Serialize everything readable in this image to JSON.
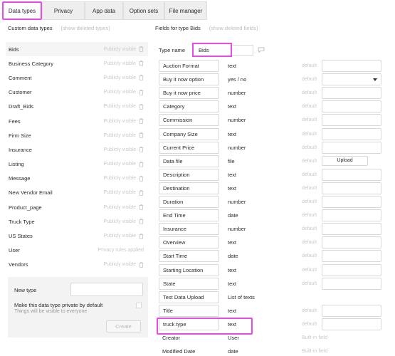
{
  "tabs": [
    {
      "label": "Data types",
      "active": true
    },
    {
      "label": "Privacy"
    },
    {
      "label": "App data"
    },
    {
      "label": "Option sets"
    },
    {
      "label": "File manager"
    }
  ],
  "left_header": {
    "title": "Custom data types",
    "link": "(show deleted types)"
  },
  "right_header": {
    "title": "Fields for type Bids",
    "link": "(show deleted fields)"
  },
  "types": [
    {
      "name": "Bids",
      "status": "Publicly visible",
      "selected": true
    },
    {
      "name": "Business Category",
      "status": "Publicly visible"
    },
    {
      "name": "Comment",
      "status": "Publicly visible"
    },
    {
      "name": "Customer",
      "status": "Publicly visible"
    },
    {
      "name": "Draft_Bids",
      "status": "Publicly visible"
    },
    {
      "name": "Fees",
      "status": "Publicly visible"
    },
    {
      "name": "Firm Size",
      "status": "Publicly visible"
    },
    {
      "name": "Insurance",
      "status": "Publicly visible"
    },
    {
      "name": "Listing",
      "status": "Publicly visible"
    },
    {
      "name": "Message",
      "status": "Publicly visible"
    },
    {
      "name": "New Vendor Email",
      "status": "Publicly visible"
    },
    {
      "name": "Product_page",
      "status": "Publicly visible"
    },
    {
      "name": "Truck Type",
      "status": "Publicly visible"
    },
    {
      "name": "US States",
      "status": "Publicly visible"
    },
    {
      "name": "User",
      "status": "Privacy rules applied"
    },
    {
      "name": "Vendors",
      "status": "Publicly visible"
    }
  ],
  "new_type": {
    "label": "New type",
    "private_label": "Make this data type private by default",
    "private_sub": "Things will be visible to everyone",
    "create_label": "Create"
  },
  "type_name": {
    "label": "Type name",
    "value": "Bids"
  },
  "fields": [
    {
      "name": "Auction Format",
      "type": "text",
      "default": "default",
      "control": "input"
    },
    {
      "name": "Buy it now option",
      "type": "yes / no",
      "default": "default",
      "control": "select"
    },
    {
      "name": "Buy it now price",
      "type": "number",
      "default": "default",
      "control": "input"
    },
    {
      "name": "Category",
      "type": "text",
      "default": "default",
      "control": "input"
    },
    {
      "name": "Commission",
      "type": "number",
      "default": "default",
      "control": "input"
    },
    {
      "name": "Company Size",
      "type": "text",
      "default": "default",
      "control": "input"
    },
    {
      "name": "Current Price",
      "type": "number",
      "default": "default",
      "control": "input"
    },
    {
      "name": "Data file",
      "type": "file",
      "default": "default",
      "control": "upload",
      "upload_label": "Upload"
    },
    {
      "name": "Description",
      "type": "text",
      "default": "default",
      "control": "input"
    },
    {
      "name": "Destination",
      "type": "text",
      "default": "default",
      "control": "input"
    },
    {
      "name": "Duration",
      "type": "number",
      "default": "default",
      "control": "input"
    },
    {
      "name": "End Time",
      "type": "date",
      "default": "default",
      "control": "input"
    },
    {
      "name": "Insurance",
      "type": "number",
      "default": "default",
      "control": "input"
    },
    {
      "name": "Overview",
      "type": "text",
      "default": "default",
      "control": "input"
    },
    {
      "name": "Start Time",
      "type": "date",
      "default": "default",
      "control": "input"
    },
    {
      "name": "Starting Location",
      "type": "text",
      "default": "default",
      "control": "input"
    },
    {
      "name": "State",
      "type": "text",
      "default": "default",
      "control": "input"
    },
    {
      "name": "Test Data Upload",
      "type": "List of texts",
      "default": "",
      "control": "none"
    },
    {
      "name": "Title",
      "type": "text",
      "default": "default",
      "control": "input"
    },
    {
      "name": "truck type",
      "type": "text",
      "default": "default",
      "control": "input",
      "highlighted": true
    },
    {
      "name": "Creator",
      "type": "User",
      "builtin": "Built-in field",
      "control": "builtin"
    },
    {
      "name": "Modified Date",
      "type": "date",
      "builtin": "Built-in field",
      "control": "builtin"
    }
  ],
  "colors": {
    "highlight": "#e94be9",
    "muted": "#cacaca"
  }
}
